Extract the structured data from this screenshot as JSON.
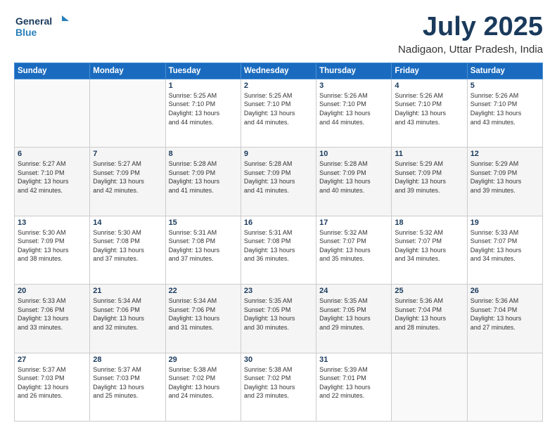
{
  "header": {
    "logo_line1": "General",
    "logo_line2": "Blue",
    "month": "July 2025",
    "location": "Nadigaon, Uttar Pradesh, India"
  },
  "weekdays": [
    "Sunday",
    "Monday",
    "Tuesday",
    "Wednesday",
    "Thursday",
    "Friday",
    "Saturday"
  ],
  "weeks": [
    [
      {
        "day": "",
        "info": ""
      },
      {
        "day": "",
        "info": ""
      },
      {
        "day": "1",
        "info": "Sunrise: 5:25 AM\nSunset: 7:10 PM\nDaylight: 13 hours\nand 44 minutes."
      },
      {
        "day": "2",
        "info": "Sunrise: 5:25 AM\nSunset: 7:10 PM\nDaylight: 13 hours\nand 44 minutes."
      },
      {
        "day": "3",
        "info": "Sunrise: 5:26 AM\nSunset: 7:10 PM\nDaylight: 13 hours\nand 44 minutes."
      },
      {
        "day": "4",
        "info": "Sunrise: 5:26 AM\nSunset: 7:10 PM\nDaylight: 13 hours\nand 43 minutes."
      },
      {
        "day": "5",
        "info": "Sunrise: 5:26 AM\nSunset: 7:10 PM\nDaylight: 13 hours\nand 43 minutes."
      }
    ],
    [
      {
        "day": "6",
        "info": "Sunrise: 5:27 AM\nSunset: 7:10 PM\nDaylight: 13 hours\nand 42 minutes."
      },
      {
        "day": "7",
        "info": "Sunrise: 5:27 AM\nSunset: 7:09 PM\nDaylight: 13 hours\nand 42 minutes."
      },
      {
        "day": "8",
        "info": "Sunrise: 5:28 AM\nSunset: 7:09 PM\nDaylight: 13 hours\nand 41 minutes."
      },
      {
        "day": "9",
        "info": "Sunrise: 5:28 AM\nSunset: 7:09 PM\nDaylight: 13 hours\nand 41 minutes."
      },
      {
        "day": "10",
        "info": "Sunrise: 5:28 AM\nSunset: 7:09 PM\nDaylight: 13 hours\nand 40 minutes."
      },
      {
        "day": "11",
        "info": "Sunrise: 5:29 AM\nSunset: 7:09 PM\nDaylight: 13 hours\nand 39 minutes."
      },
      {
        "day": "12",
        "info": "Sunrise: 5:29 AM\nSunset: 7:09 PM\nDaylight: 13 hours\nand 39 minutes."
      }
    ],
    [
      {
        "day": "13",
        "info": "Sunrise: 5:30 AM\nSunset: 7:09 PM\nDaylight: 13 hours\nand 38 minutes."
      },
      {
        "day": "14",
        "info": "Sunrise: 5:30 AM\nSunset: 7:08 PM\nDaylight: 13 hours\nand 37 minutes."
      },
      {
        "day": "15",
        "info": "Sunrise: 5:31 AM\nSunset: 7:08 PM\nDaylight: 13 hours\nand 37 minutes."
      },
      {
        "day": "16",
        "info": "Sunrise: 5:31 AM\nSunset: 7:08 PM\nDaylight: 13 hours\nand 36 minutes."
      },
      {
        "day": "17",
        "info": "Sunrise: 5:32 AM\nSunset: 7:07 PM\nDaylight: 13 hours\nand 35 minutes."
      },
      {
        "day": "18",
        "info": "Sunrise: 5:32 AM\nSunset: 7:07 PM\nDaylight: 13 hours\nand 34 minutes."
      },
      {
        "day": "19",
        "info": "Sunrise: 5:33 AM\nSunset: 7:07 PM\nDaylight: 13 hours\nand 34 minutes."
      }
    ],
    [
      {
        "day": "20",
        "info": "Sunrise: 5:33 AM\nSunset: 7:06 PM\nDaylight: 13 hours\nand 33 minutes."
      },
      {
        "day": "21",
        "info": "Sunrise: 5:34 AM\nSunset: 7:06 PM\nDaylight: 13 hours\nand 32 minutes."
      },
      {
        "day": "22",
        "info": "Sunrise: 5:34 AM\nSunset: 7:06 PM\nDaylight: 13 hours\nand 31 minutes."
      },
      {
        "day": "23",
        "info": "Sunrise: 5:35 AM\nSunset: 7:05 PM\nDaylight: 13 hours\nand 30 minutes."
      },
      {
        "day": "24",
        "info": "Sunrise: 5:35 AM\nSunset: 7:05 PM\nDaylight: 13 hours\nand 29 minutes."
      },
      {
        "day": "25",
        "info": "Sunrise: 5:36 AM\nSunset: 7:04 PM\nDaylight: 13 hours\nand 28 minutes."
      },
      {
        "day": "26",
        "info": "Sunrise: 5:36 AM\nSunset: 7:04 PM\nDaylight: 13 hours\nand 27 minutes."
      }
    ],
    [
      {
        "day": "27",
        "info": "Sunrise: 5:37 AM\nSunset: 7:03 PM\nDaylight: 13 hours\nand 26 minutes."
      },
      {
        "day": "28",
        "info": "Sunrise: 5:37 AM\nSunset: 7:03 PM\nDaylight: 13 hours\nand 25 minutes."
      },
      {
        "day": "29",
        "info": "Sunrise: 5:38 AM\nSunset: 7:02 PM\nDaylight: 13 hours\nand 24 minutes."
      },
      {
        "day": "30",
        "info": "Sunrise: 5:38 AM\nSunset: 7:02 PM\nDaylight: 13 hours\nand 23 minutes."
      },
      {
        "day": "31",
        "info": "Sunrise: 5:39 AM\nSunset: 7:01 PM\nDaylight: 13 hours\nand 22 minutes."
      },
      {
        "day": "",
        "info": ""
      },
      {
        "day": "",
        "info": ""
      }
    ]
  ]
}
